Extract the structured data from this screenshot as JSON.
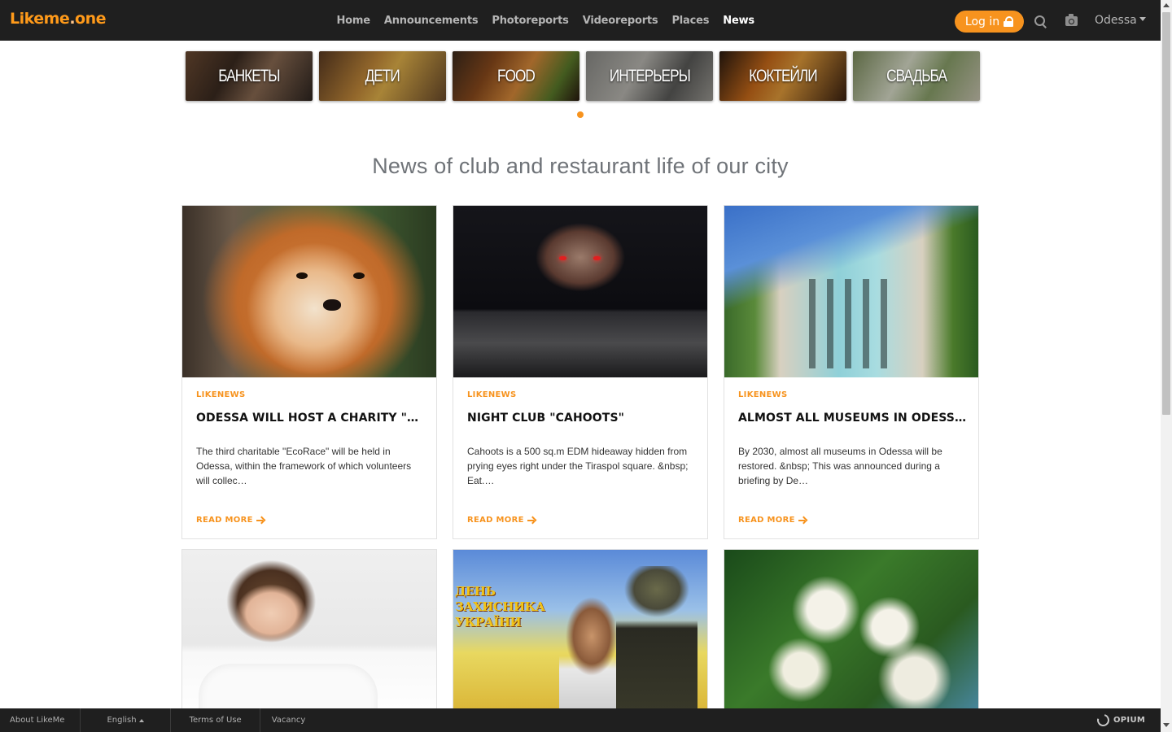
{
  "header": {
    "logo_main": "Likeme",
    "logo_dot": ".",
    "logo_end": "one",
    "nav": [
      {
        "label": "Home"
      },
      {
        "label": "Announcements"
      },
      {
        "label": "Photoreports"
      },
      {
        "label": "Videoreports"
      },
      {
        "label": "Places"
      },
      {
        "label": "News",
        "active": true
      }
    ],
    "login_label": "Log in",
    "city": "Odessa"
  },
  "categories": [
    {
      "label": "БАНКЕТЫ"
    },
    {
      "label": "ДЕТИ"
    },
    {
      "label": "FOOD"
    },
    {
      "label": "ИНТЕРЬЕРЫ"
    },
    {
      "label": "КОКТЕЙЛИ"
    },
    {
      "label": "СВАДЬБА"
    }
  ],
  "page_title": "News of club and restaurant life of our city",
  "cards": [
    {
      "category": "LIKENEWS",
      "title": "ODESSA WILL HOST A CHARITY \"ECORACE\"",
      "text": "The third charitable \"EcoRace\" will be held in Odessa, within the framework of which volunteers will collec…",
      "read_more": "READ MORE"
    },
    {
      "category": "LIKENEWS",
      "title": "NIGHT CLUB \"CAHOOTS\"",
      "text": "Cahoots is a 500 sq.m EDM hideaway hidden from prying eyes right under the Tiraspol square. &nbsp; Eat.…",
      "read_more": "READ MORE"
    },
    {
      "category": "LIKENEWS",
      "title": "ALMOST ALL MUSEUMS IN ODESSA ARE TO BE RESTORED",
      "text": "By 2030, almost all museums in Odessa will be restored. &nbsp; This was announced during a briefing by De…",
      "read_more": "READ MORE"
    }
  ],
  "poster_text": {
    "line1": "ДЕНЬ",
    "line2": "ЗАХИСНИКА",
    "line3": "УКРАЇНИ"
  },
  "footer": {
    "about": "About LikeMe",
    "language": "English",
    "terms": "Terms of Use",
    "vacancy": "Vacancy",
    "brand": "OPIUM"
  },
  "colors": {
    "accent": "#f7931e",
    "header_bg": "#1f1f1f",
    "title_gray": "#6f7378"
  }
}
